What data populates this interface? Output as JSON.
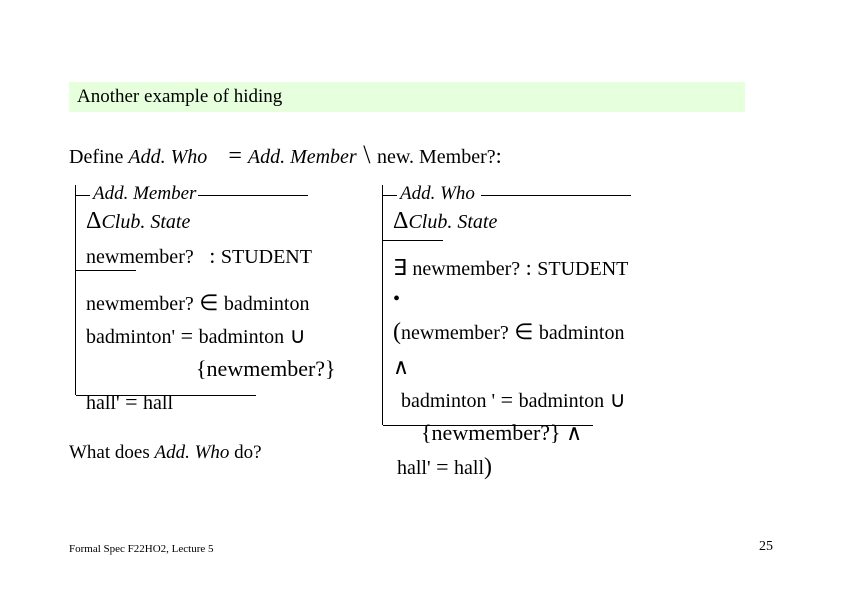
{
  "title": "Another example of hiding",
  "define": {
    "prefix": "Define ",
    "lhs": "Add. Who",
    "eq": " = ",
    "rhs": "Add. Member",
    "hideOp": " \\ ",
    "hidden": "new. Member?",
    "colon": ":"
  },
  "leftSchema": {
    "name": "Add. Member",
    "delta": "Δ",
    "deltaTarget": "Club. State",
    "decl2_a": "newmember?",
    "decl2_colon": " : ",
    "decl2_b": "STUDENT",
    "p1_a": "newmember?",
    "p1_in": " ∈ ",
    "p1_b": "badminton",
    "p2_a": "badminton'",
    "p2_eq": " = ",
    "p2_b": "badminton",
    "p2_cup": " ∪",
    "p3": "{newmember?}",
    "p4_a": "hall'",
    "p4_eq": " = ",
    "p4_b": "hall"
  },
  "rightSchema": {
    "name": "Add. Who",
    "delta": "Δ",
    "deltaTarget": "Club. State",
    "exists": "∃ ",
    "existsVar": "newmember?",
    "existsColon": " : ",
    "existsType": "STUDENT",
    "spot": " •",
    "lpar": "(",
    "r1_a": "newmember?",
    "r1_in": " ∈ ",
    "r1_b": "badminton",
    "r1_and": " ∧",
    "r2_a": "badminton",
    "r2_prime": " '",
    "r2_eq": " = ",
    "r2_b": "badminton",
    "r2_cup": " ∪",
    "r3": "{newmember?}",
    "r3_and": " ∧",
    "r4_a": "hall",
    "r4_prime": "'",
    "r4_eq": " = ",
    "r4_b": "hall",
    "rpar": ")"
  },
  "question": {
    "prefix": "What does ",
    "subject": "Add. Who",
    "suffix": " do?"
  },
  "footer": {
    "left": "Formal Spec F22HO2, Lecture 5",
    "right": "25"
  }
}
